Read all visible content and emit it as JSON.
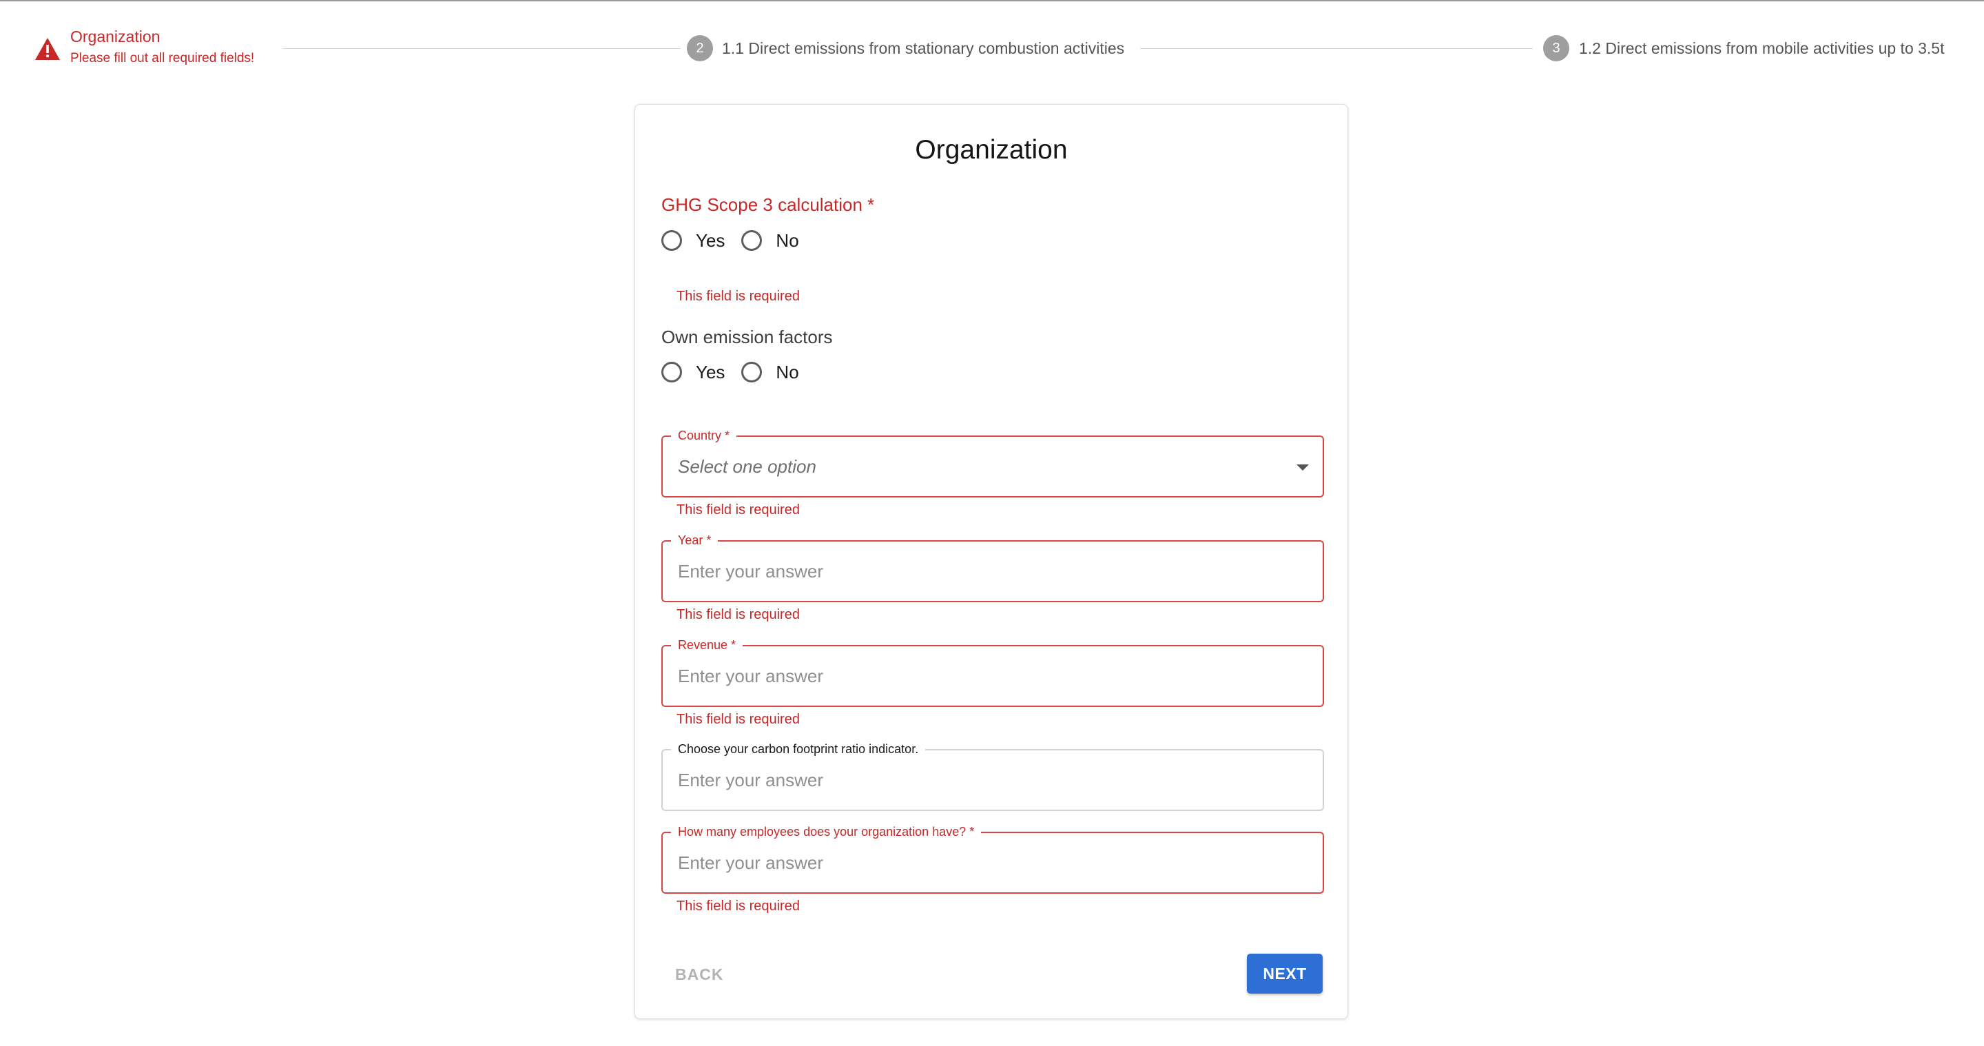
{
  "stepper": {
    "step1": {
      "title": "Organization",
      "subtitle": "Please fill out all required fields!",
      "icon": "warning-icon",
      "color": "#c62828"
    },
    "step2": {
      "number": "2",
      "label": "1.1 Direct emissions from stationary combustion activities"
    },
    "step3": {
      "number": "3",
      "label": "1.2 Direct emissions from mobile activities up to 3.5t"
    }
  },
  "form": {
    "title": "Organization",
    "ghg_scope": {
      "label": "GHG Scope 3 calculation *",
      "options": [
        "Yes",
        "No"
      ],
      "error": "This field is required"
    },
    "own_factors": {
      "label": "Own emission factors",
      "options": [
        "Yes",
        "No"
      ]
    },
    "country": {
      "label": "Country *",
      "placeholder": "Select one option",
      "error": "This field is required"
    },
    "year": {
      "label": "Year *",
      "placeholder": "Enter your answer",
      "error": "This field is required"
    },
    "revenue": {
      "label": "Revenue *",
      "placeholder": "Enter your answer",
      "error": "This field is required"
    },
    "ratio": {
      "label": "Choose your carbon footprint ratio indicator.",
      "placeholder": "Enter your answer"
    },
    "employees": {
      "label": "How many employees does your organization have? *",
      "placeholder": "Enter your answer",
      "error": "This field is required"
    },
    "buttons": {
      "back": "BACK",
      "next": "NEXT"
    }
  },
  "colors": {
    "error": "#c62828",
    "primary": "#2d6fd4",
    "inactive_step": "#9e9e9e"
  }
}
